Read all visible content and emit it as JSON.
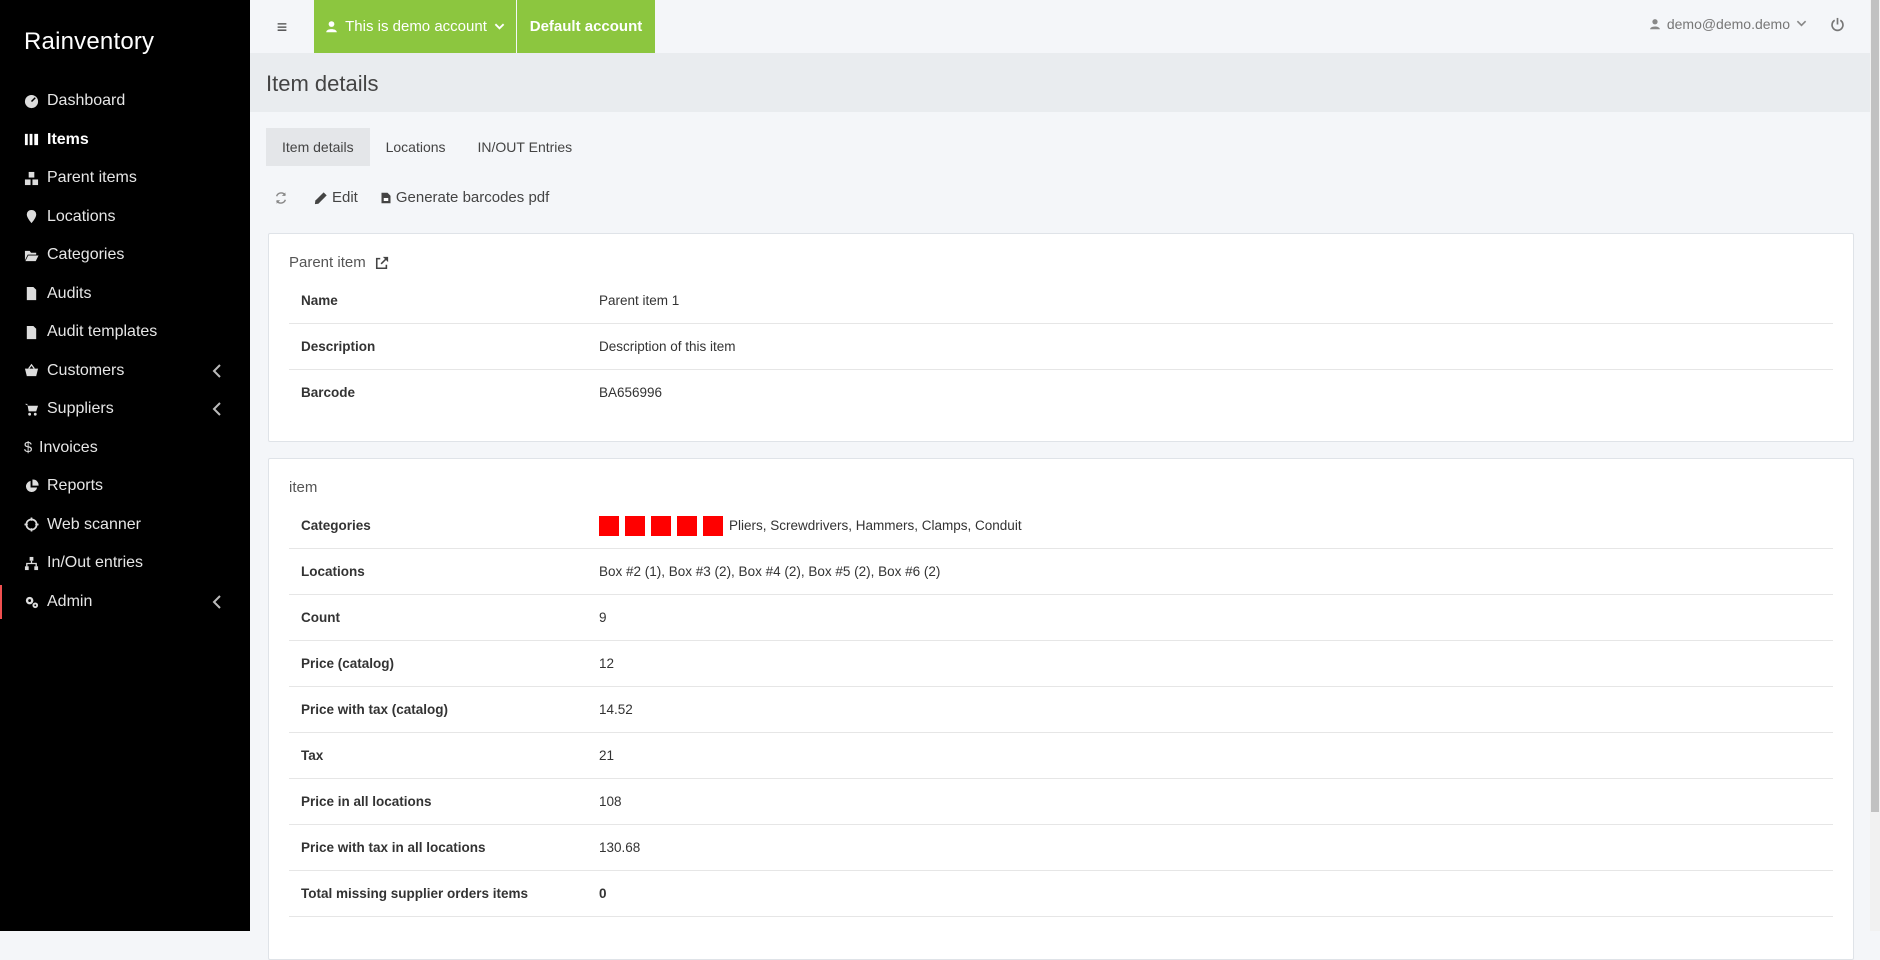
{
  "brand": "Rainventory",
  "sidebar": {
    "items": [
      {
        "label": "Dashboard",
        "icon": "dashboard-icon",
        "active": false,
        "expandable": false
      },
      {
        "label": "Items",
        "icon": "columns-icon",
        "active": true,
        "expandable": false
      },
      {
        "label": "Parent items",
        "icon": "boxes-icon",
        "active": false,
        "expandable": false
      },
      {
        "label": "Locations",
        "icon": "map-marker-icon",
        "active": false,
        "expandable": false
      },
      {
        "label": "Categories",
        "icon": "folder-open-icon",
        "active": false,
        "expandable": false
      },
      {
        "label": "Audits",
        "icon": "file-icon",
        "active": false,
        "expandable": false
      },
      {
        "label": "Audit templates",
        "icon": "file-icon",
        "active": false,
        "expandable": false
      },
      {
        "label": "Customers",
        "icon": "basket-icon",
        "active": false,
        "expandable": true
      },
      {
        "label": "Suppliers",
        "icon": "cart-icon",
        "active": false,
        "expandable": true
      },
      {
        "label": "Invoices",
        "icon": "dollar-icon",
        "active": false,
        "expandable": false
      },
      {
        "label": "Reports",
        "icon": "pie-chart-icon",
        "active": false,
        "expandable": false
      },
      {
        "label": "Web scanner",
        "icon": "crosshairs-icon",
        "active": false,
        "expandable": false
      },
      {
        "label": "In/Out entries",
        "icon": "sitemap-icon",
        "active": false,
        "expandable": false
      },
      {
        "label": "Admin",
        "icon": "cogs-icon",
        "active": false,
        "expandable": true
      }
    ]
  },
  "topbar": {
    "demo_label": "This is demo account",
    "default_label": "Default account",
    "user_email": "demo@demo.demo"
  },
  "page": {
    "title": "Item details"
  },
  "tabs": [
    "Item details",
    "Locations",
    "IN/OUT Entries"
  ],
  "toolbar": {
    "edit_label": "Edit",
    "barcodes_label": "Generate barcodes pdf"
  },
  "parent_card": {
    "title": "Parent item",
    "rows": [
      {
        "label": "Name",
        "value": "Parent item 1"
      },
      {
        "label": "Description",
        "value": "Description of this item"
      },
      {
        "label": "Barcode",
        "value": "BA656996"
      }
    ]
  },
  "item_card": {
    "title": "item",
    "category_color": "#ff0000",
    "category_swatch_count": 5,
    "rows": [
      {
        "label": "Categories",
        "value": "Pliers, Screwdrivers, Hammers, Clamps, Conduit"
      },
      {
        "label": "Locations",
        "value": "Box #2 (1), Box #3 (2), Box #4 (2), Box #5 (2), Box #6 (2)"
      },
      {
        "label": "Count",
        "value": "9"
      },
      {
        "label": "Price (catalog)",
        "value": "12"
      },
      {
        "label": "Price with tax (catalog)",
        "value": "14.52"
      },
      {
        "label": "Tax",
        "value": "21"
      },
      {
        "label": "Price in all locations",
        "value": "108"
      },
      {
        "label": "Price with tax in all locations",
        "value": "130.68"
      },
      {
        "label": "Total missing supplier orders items",
        "value": "0"
      }
    ]
  },
  "colors": {
    "accent_green": "#8cc63f",
    "sidebar_bg": "#000000",
    "active_marker": "#f05050"
  }
}
